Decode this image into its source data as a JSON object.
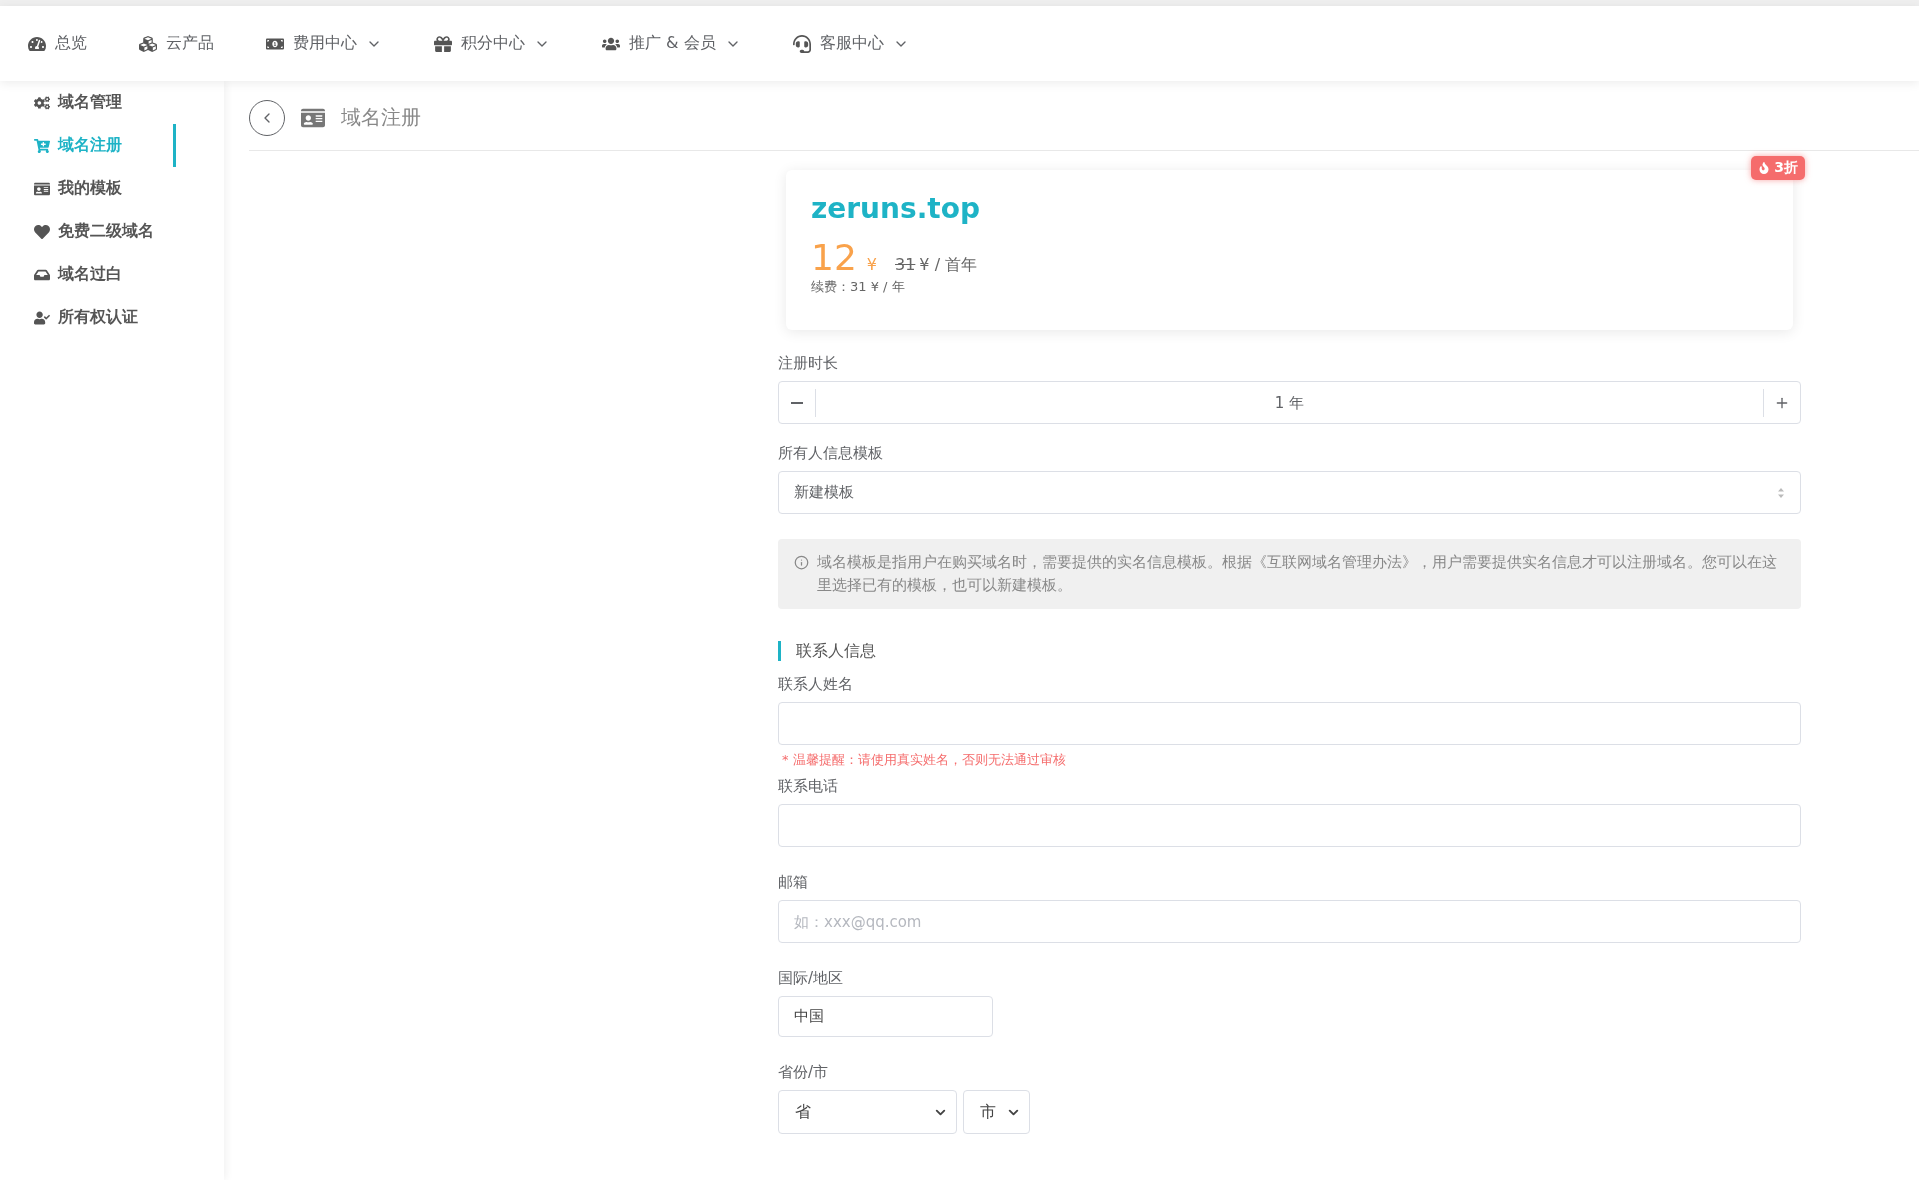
{
  "top_nav": [
    {
      "label": "总览",
      "dropdown": false
    },
    {
      "label": "云产品",
      "dropdown": false
    },
    {
      "label": "费用中心",
      "dropdown": true
    },
    {
      "label": "积分中心",
      "dropdown": true
    },
    {
      "label": "推广 & 会员",
      "dropdown": true
    },
    {
      "label": "客服中心",
      "dropdown": true
    }
  ],
  "sidebar": {
    "items": [
      {
        "label": "域名管理",
        "selected": false
      },
      {
        "label": "域名注册",
        "selected": true
      },
      {
        "label": "我的模板",
        "selected": false
      },
      {
        "label": "免费二级域名",
        "selected": false
      },
      {
        "label": "域名过白",
        "selected": false
      },
      {
        "label": "所有权认证",
        "selected": false
      }
    ]
  },
  "page_title": "域名注册",
  "domain_card": {
    "domain": "zeruns.top",
    "badge": "3折",
    "price": "12",
    "currency": "¥",
    "original_price": "31",
    "price_unit": "¥ / 首年",
    "renewal": "续费：31 ¥ / 年"
  },
  "form": {
    "duration": {
      "label": "注册时长",
      "value": "1 年"
    },
    "template": {
      "label": "所有人信息模板",
      "value": "新建模板"
    },
    "notice": "域名模板是指用户在购买域名时，需要提供的实名信息模板。根据《互联网域名管理办法》，用户需要提供实名信息才可以注册域名。您可以在这里选择已有的模板，也可以新建模板。",
    "section_title": "联系人信息",
    "name": {
      "label": "联系人姓名",
      "warning": "* 温馨提醒：请使用真实姓名，否则无法通过审核"
    },
    "phone": {
      "label": "联系电话"
    },
    "email": {
      "label": "邮箱",
      "placeholder": "如：xxx@qq.com"
    },
    "country": {
      "label": "国际/地区",
      "value": "中国"
    },
    "region": {
      "label": "省份/市",
      "province": "省",
      "city": "市"
    }
  }
}
